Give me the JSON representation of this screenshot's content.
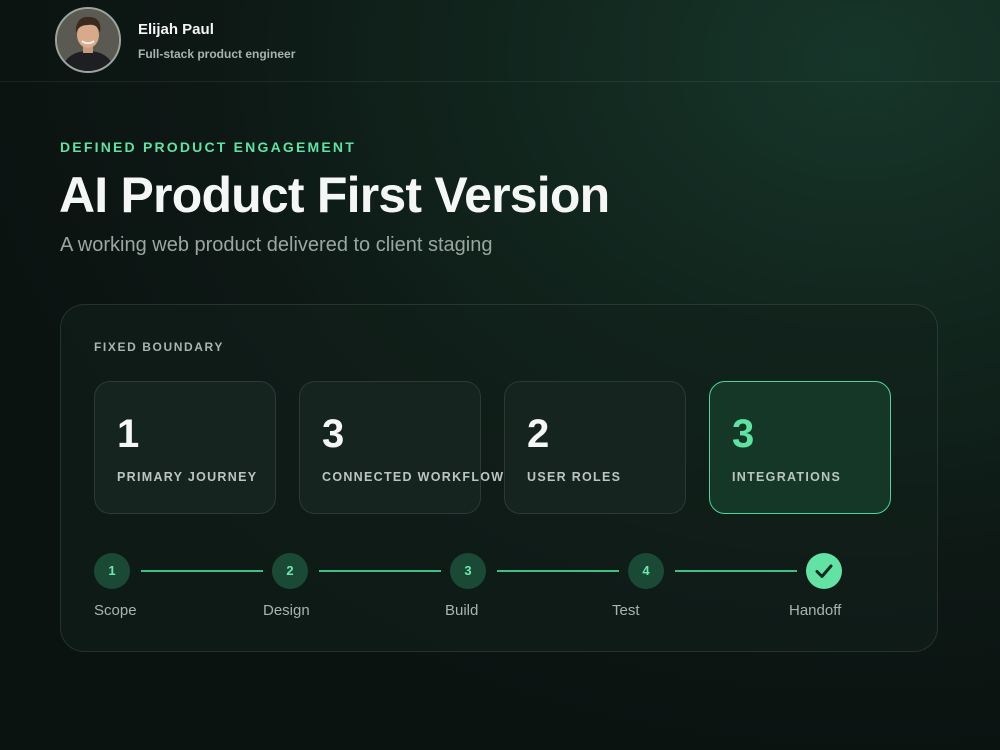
{
  "profile": {
    "name": "Elijah Paul",
    "role": "Full-stack product engineer"
  },
  "hero": {
    "eyebrow": "DEFINED PRODUCT ENGAGEMENT",
    "title": "AI Product First Version",
    "subtitle": "A working web product delivered to client staging"
  },
  "boundary": {
    "label": "FIXED BOUNDARY",
    "stats": [
      {
        "value": "1",
        "label": "PRIMARY JOURNEY"
      },
      {
        "value": "3",
        "label": "CONNECTED WORKFLOWS"
      },
      {
        "value": "2",
        "label": "USER ROLES"
      },
      {
        "value": "3",
        "label": "INTEGRATIONS",
        "highlighted": true
      }
    ]
  },
  "steps": [
    {
      "number": "1",
      "label": "Scope"
    },
    {
      "number": "2",
      "label": "Design"
    },
    {
      "number": "3",
      "label": "Build"
    },
    {
      "number": "4",
      "label": "Test"
    },
    {
      "number": "",
      "label": "Handoff",
      "completed": true,
      "icon": "check-icon"
    }
  ],
  "colors": {
    "accent": "#5fe3a2",
    "background": "#0d1714",
    "card": "#15241f"
  }
}
